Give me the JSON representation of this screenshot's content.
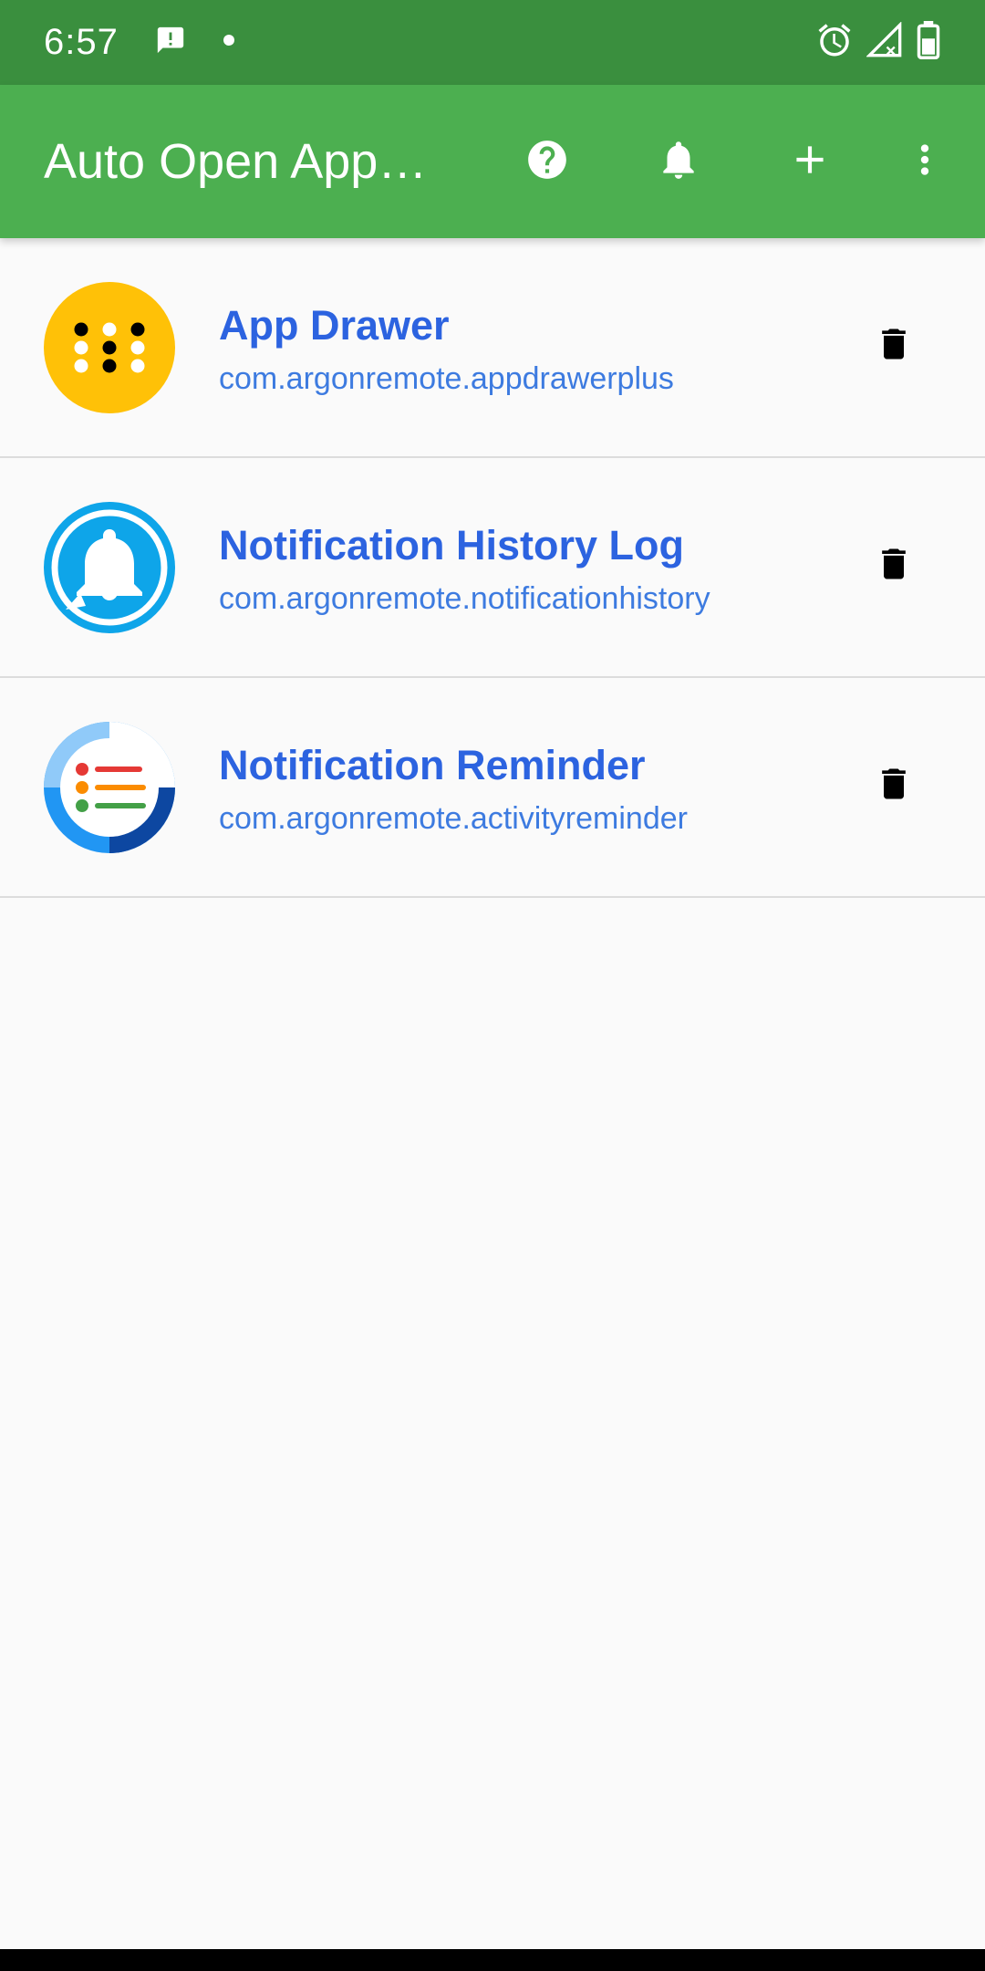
{
  "status_bar": {
    "time": "6:57"
  },
  "app_bar": {
    "title": "Auto Open App…",
    "actions": [
      {
        "icon": "help-icon"
      },
      {
        "icon": "bell-icon"
      },
      {
        "icon": "plus-icon"
      },
      {
        "icon": "more-vert-icon"
      }
    ]
  },
  "apps": [
    {
      "name": "App Drawer",
      "package": "com.argonremote.appdrawerplus",
      "icon": "app-drawer-icon"
    },
    {
      "name": "Notification History Log",
      "package": "com.argonremote.notificationhistory",
      "icon": "notification-history-icon"
    },
    {
      "name": "Notification Reminder",
      "package": "com.argonremote.activityreminder",
      "icon": "notification-reminder-icon"
    }
  ],
  "colors": {
    "status_bar": "#3a8f3e",
    "app_bar": "#4caf50",
    "title_text": "#2c63e0",
    "package_text": "#3d7be0",
    "background": "#fafafa"
  }
}
